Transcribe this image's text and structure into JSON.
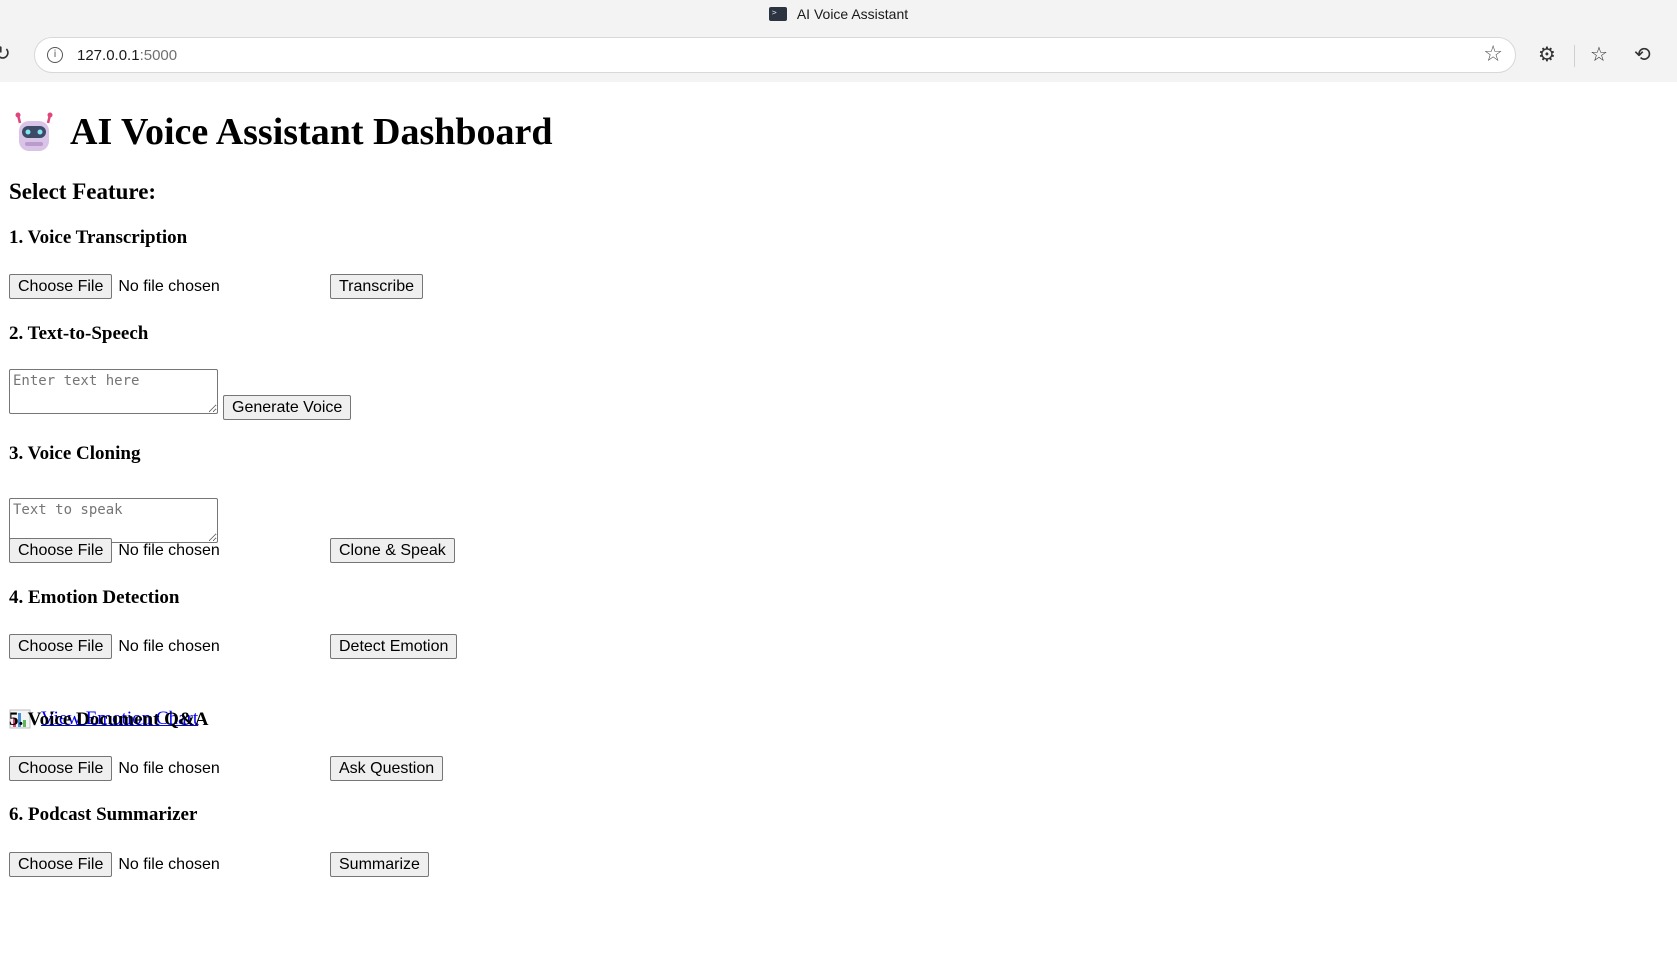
{
  "browser": {
    "window_title": "AI Voice Assistant",
    "url_host": "127.0.0.1",
    "url_port": ":5000"
  },
  "page": {
    "title": "AI Voice Assistant Dashboard",
    "select_label": "Select Feature:"
  },
  "file_input": {
    "button_label": "Choose File",
    "status": "No file chosen"
  },
  "sections": {
    "transcription": {
      "heading": "1. Voice Transcription",
      "action": "Transcribe"
    },
    "tts": {
      "heading": "2. Text-to-Speech",
      "placeholder": "Enter text here",
      "action": "Generate Voice"
    },
    "cloning": {
      "heading": "3. Voice Cloning",
      "placeholder": "Text to speak",
      "action": "Clone & Speak"
    },
    "emotion": {
      "heading": "4. Emotion Detection",
      "action": "Detect Emotion",
      "chart_link": "View Emotion Chart"
    },
    "doc_qa": {
      "heading": "5. Voice Document Q&A",
      "action": "Ask Question"
    },
    "podcast": {
      "heading": "6. Podcast Summarizer",
      "action": "Summarize"
    }
  },
  "icons": {
    "title_icon": "robot-icon",
    "chart_icon": "bar-chart-icon"
  },
  "colors": {
    "link": "#0000ee",
    "button_bg": "#efefef"
  }
}
